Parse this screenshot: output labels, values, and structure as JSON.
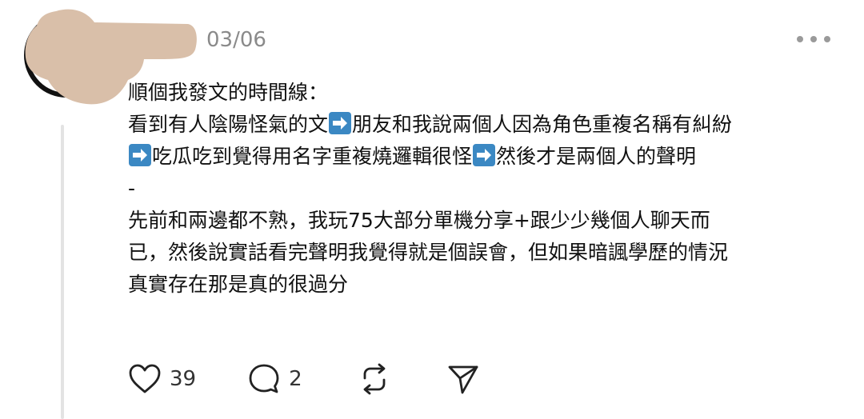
{
  "post": {
    "date": "03/06",
    "lines": [
      "順個我發文的時間線：",
      "看到有人陰陽怪氣的文",
      "朋友和我說兩個人因為角色重複名稱有糾紛",
      "吃瓜吃到覺得用名字重複燒邏輯很怪",
      "然後才是兩個人的聲明",
      "-",
      "先前和兩邊都不熟，我玩75大部分單機分享+跟少少幾個人聊天而",
      "已，然後說實話看完聲明我覺得就是個誤會，但如果暗諷學歷的情況",
      "真實存在那是真的很過分"
    ]
  },
  "actions": {
    "likes": "39",
    "replies": "2"
  },
  "icons": {
    "like": "heart-icon",
    "reply": "comment-bubble-icon",
    "repost": "repost-icon",
    "share": "send-icon",
    "more": "more-dots-icon",
    "arrow": "right-arrow-emoji-icon"
  },
  "colors": {
    "date": "#8a8a8a",
    "arrow_emoji": "#3b88c3",
    "redaction": "#d9bfa9"
  }
}
